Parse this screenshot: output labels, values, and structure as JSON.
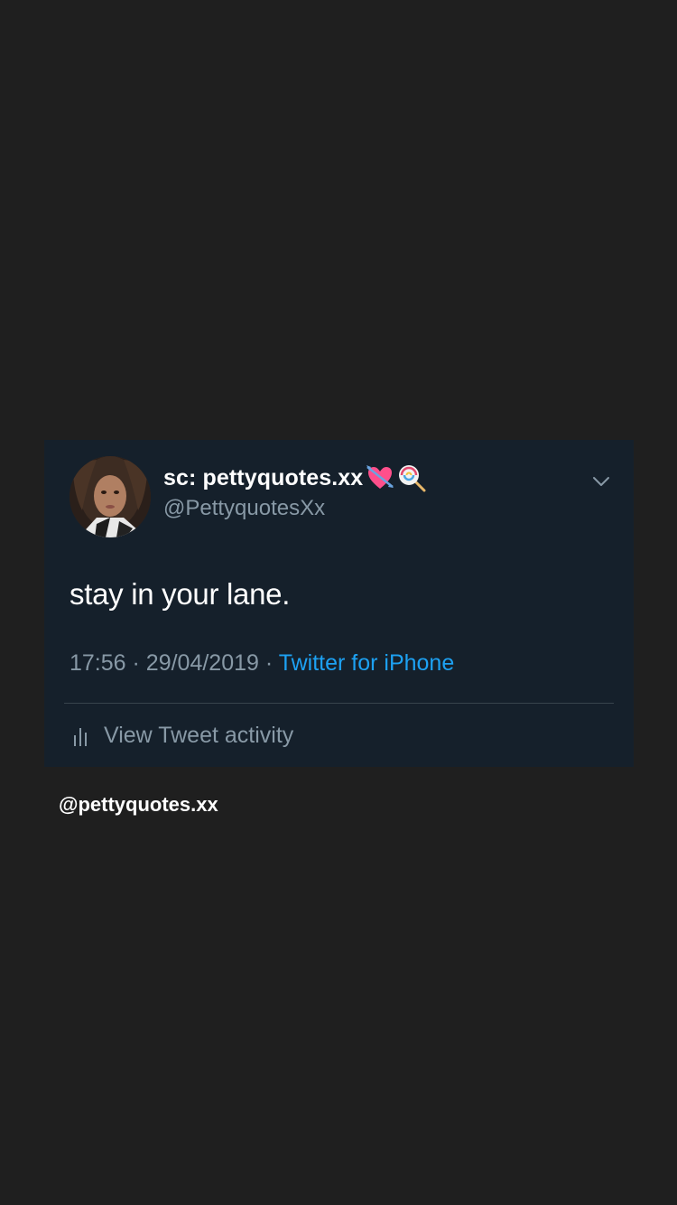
{
  "tweet": {
    "display_name": "sc: pettyquotes.xx",
    "name_emojis": [
      "heart-with-arrow-icon",
      "lollipop-icon"
    ],
    "handle": "@PettyquotesXx",
    "text": "stay in your lane.",
    "time": "17:56",
    "separator": "·",
    "date": "29/04/2019",
    "source": "Twitter for iPhone",
    "activity_label": "View Tweet activity"
  },
  "watermark": "@pettyquotes.xx",
  "colors": {
    "background": "#1f1f1f",
    "card": "#15202b",
    "link": "#1da1f2",
    "secondary_text": "#8899a6",
    "divider": "#38444d"
  }
}
